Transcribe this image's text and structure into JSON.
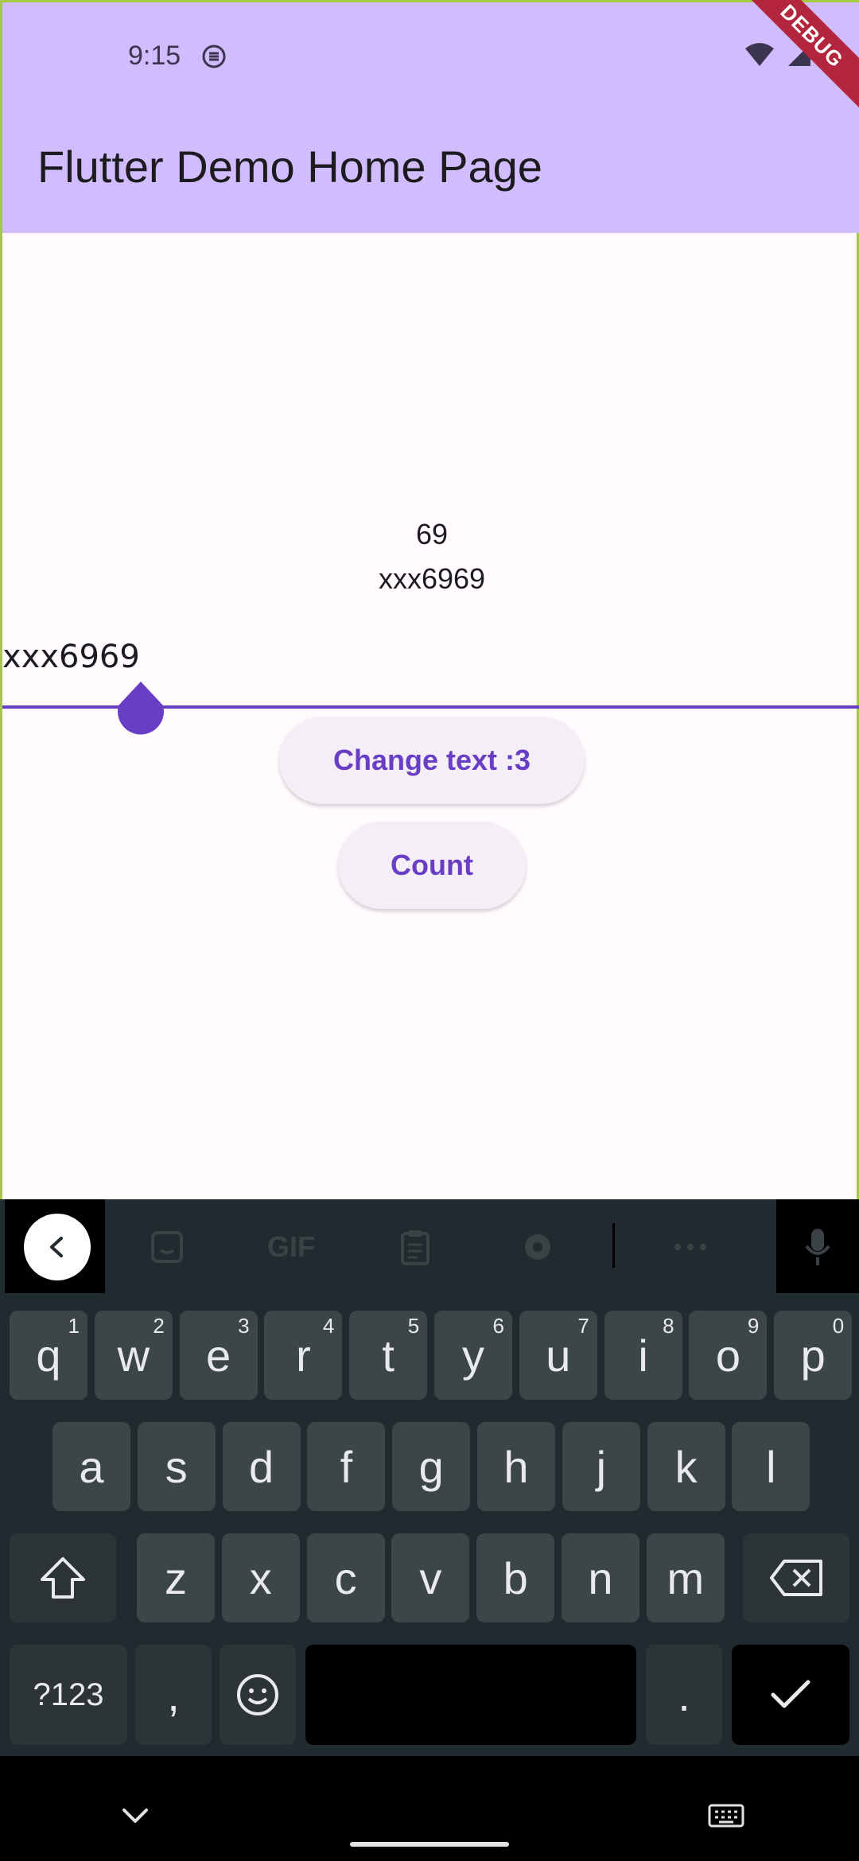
{
  "status_bar": {
    "time": "9:15"
  },
  "debug_banner": "DEBUG",
  "app_bar": {
    "title": "Flutter Demo Home Page"
  },
  "main": {
    "counter": "69",
    "label": "xxx6969",
    "text_field_value": "xxx6969",
    "change_text_button": "Change text :3",
    "count_button": "Count"
  },
  "keyboard": {
    "toolbar_icons": [
      "back-icon",
      "sticker-icon",
      "gif-icon",
      "clipboard-icon",
      "settings-icon",
      "more-icon",
      "mic-icon"
    ],
    "toolbar_gif_label": "GIF",
    "row1": [
      {
        "k": "q",
        "h": "1"
      },
      {
        "k": "w",
        "h": "2"
      },
      {
        "k": "e",
        "h": "3"
      },
      {
        "k": "r",
        "h": "4"
      },
      {
        "k": "t",
        "h": "5"
      },
      {
        "k": "y",
        "h": "6"
      },
      {
        "k": "u",
        "h": "7"
      },
      {
        "k": "i",
        "h": "8"
      },
      {
        "k": "o",
        "h": "9"
      },
      {
        "k": "p",
        "h": "0"
      }
    ],
    "row2": [
      "a",
      "s",
      "d",
      "f",
      "g",
      "h",
      "j",
      "k",
      "l"
    ],
    "row3": [
      "z",
      "x",
      "c",
      "v",
      "b",
      "n",
      "m"
    ],
    "symbols_key": "?123",
    "comma_key": ",",
    "period_key": ".",
    "colors": {
      "key": "#3c4649",
      "background": "#212a2e",
      "accent": "#6a3ec4"
    }
  }
}
